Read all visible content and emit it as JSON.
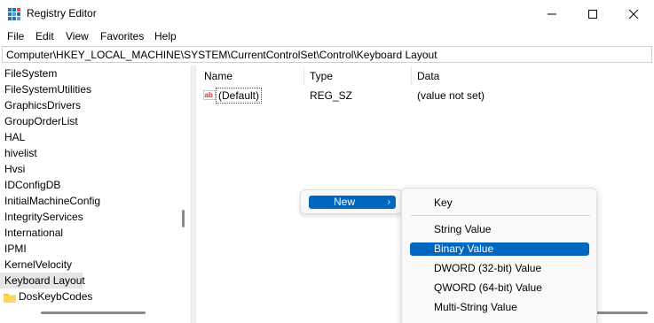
{
  "window": {
    "title": "Registry Editor"
  },
  "menu": [
    "File",
    "Edit",
    "View",
    "Favorites",
    "Help"
  ],
  "address": "Computer\\HKEY_LOCAL_MACHINE\\SYSTEM\\CurrentControlSet\\Control\\Keyboard Layout",
  "tree": {
    "items": [
      "FileSystem",
      "FileSystemUtilities",
      "GraphicsDrivers",
      "GroupOrderList",
      "HAL",
      "hivelist",
      "Hvsi",
      "IDConfigDB",
      "InitialMachineConfig",
      "IntegrityServices",
      "International",
      "IPMI",
      "KernelVelocity",
      "Keyboard Layout"
    ],
    "selected": "Keyboard Layout",
    "subfolder": "DosKeybCodes"
  },
  "list": {
    "columns": [
      "Name",
      "Type",
      "Data"
    ],
    "rows": [
      {
        "name": "(Default)",
        "type": "REG_SZ",
        "data": "(value not set)",
        "icon": "string-value-icon"
      }
    ]
  },
  "context_menu": {
    "label": "New",
    "submenu": [
      "Key",
      "String Value",
      "Binary Value",
      "DWORD (32-bit) Value",
      "QWORD (64-bit) Value",
      "Multi-String Value"
    ],
    "highlighted": "Binary Value"
  },
  "colors": {
    "accent": "#0067c0",
    "selection_gray": "#e5e5e5"
  }
}
